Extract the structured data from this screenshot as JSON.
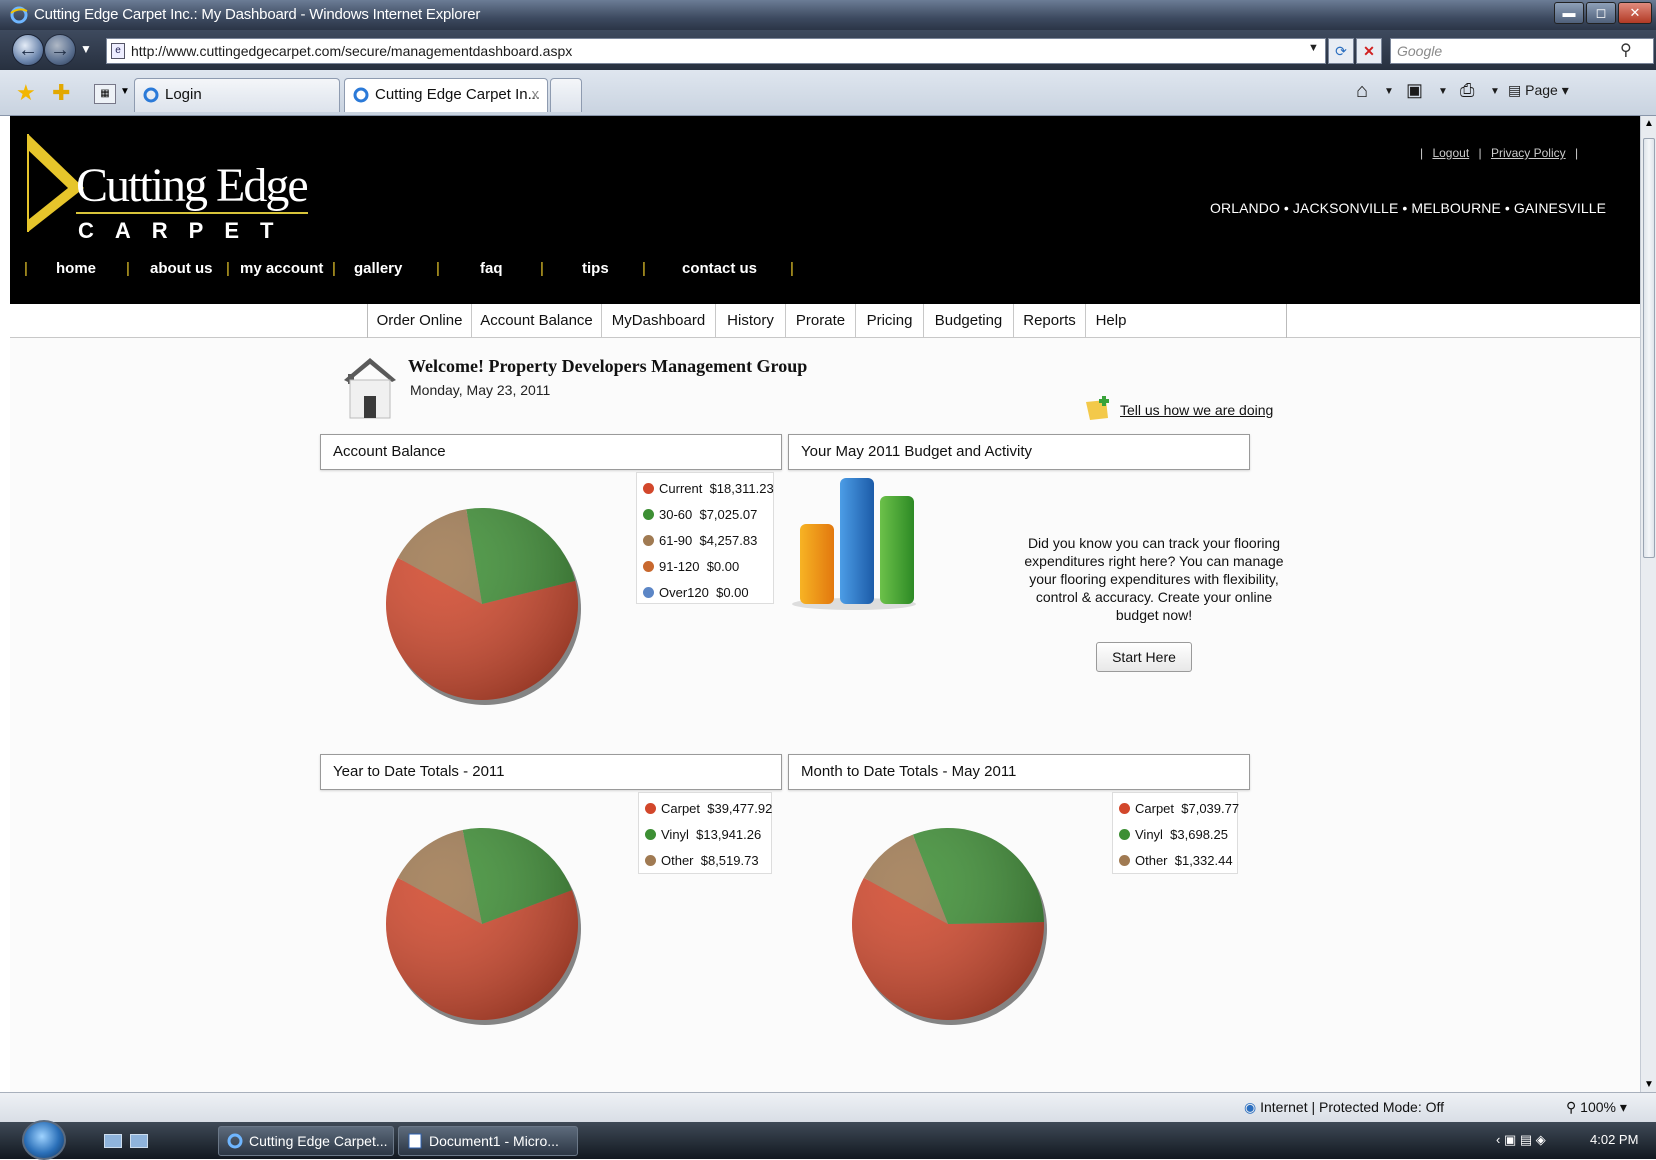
{
  "window": {
    "title": "Cutting Edge Carpet Inc.: My Dashboard - Windows Internet Explorer"
  },
  "browser": {
    "url": "http://www.cuttingedgecarpet.com/secure/managementdashboard.aspx",
    "search_placeholder": "Google",
    "tabs": [
      {
        "label": "Login"
      },
      {
        "label": "Cutting Edge Carpet In..."
      }
    ],
    "page_menu_label": "Page",
    "status_zone": "Internet | Protected Mode: Off",
    "zoom": "100%"
  },
  "site": {
    "logo_line1": "Cutting Edge",
    "logo_line2": "CARPET",
    "links": {
      "logout": "Logout",
      "privacy": "Privacy Policy"
    },
    "cities": "ORLANDO • JACKSONVILLE • MELBOURNE • GAINESVILLE",
    "main_nav": [
      "home",
      "about us",
      "my account",
      "gallery",
      "faq",
      "tips",
      "contact us"
    ],
    "sub_nav": [
      "Order Online",
      "Account Balance",
      "MyDashboard",
      "History",
      "Prorate",
      "Pricing",
      "Budgeting",
      "Reports",
      "Help"
    ]
  },
  "dashboard": {
    "welcome": "Welcome! Property Developers Management Group",
    "date": "Monday, May 23, 2011",
    "feedback_link": "Tell us how we are doing",
    "account_balance_title": "Account Balance",
    "budget_title": "Your May 2011 Budget and Activity",
    "budget_text": "Did you know you can track your flooring expenditures right here? You can manage your flooring expenditures with flexibility, control & accuracy. Create your online budget now!",
    "start_button": "Start Here",
    "ytd_title": "Year to Date Totals - 2011",
    "mtd_title": "Month to Date Totals - May 2011"
  },
  "colors": {
    "red": "#d2472b",
    "green": "#3d8f34",
    "tan": "#a07a52",
    "orange": "#c8682e",
    "blue": "#5c86c6",
    "accent_yellow": "#e6c52b"
  },
  "chart_data": [
    {
      "type": "pie",
      "title": "Account Balance",
      "labels": [
        "Current",
        "30-60",
        "61-90",
        "91-120",
        "Over120"
      ],
      "display": [
        "$18,311.23",
        "$7,025.07",
        "$4,257.83",
        "$0.00",
        "$0.00"
      ],
      "values": [
        18311.23,
        7025.07,
        4257.83,
        0,
        0
      ],
      "colors": [
        "#d2472b",
        "#3d8f34",
        "#a07a52",
        "#c8682e",
        "#5c86c6"
      ]
    },
    {
      "type": "pie",
      "title": "Year to Date Totals - 2011",
      "labels": [
        "Carpet",
        "Vinyl",
        "Other"
      ],
      "display": [
        "$39,477.92",
        "$13,941.26",
        "$8,519.73"
      ],
      "values": [
        39477.92,
        13941.26,
        8519.73
      ],
      "colors": [
        "#d2472b",
        "#3d8f34",
        "#a07a52"
      ]
    },
    {
      "type": "pie",
      "title": "Month to Date Totals - May 2011",
      "labels": [
        "Carpet",
        "Vinyl",
        "Other"
      ],
      "display": [
        "$7,039.77",
        "$3,698.25",
        "$1,332.44"
      ],
      "values": [
        7039.77,
        3698.25,
        1332.44
      ],
      "colors": [
        "#d2472b",
        "#3d8f34",
        "#a07a52"
      ]
    }
  ],
  "taskbar": {
    "tasks": [
      {
        "label": "Cutting Edge Carpet..."
      },
      {
        "label": "Document1 - Micro..."
      }
    ],
    "clock": "4:02 PM"
  }
}
